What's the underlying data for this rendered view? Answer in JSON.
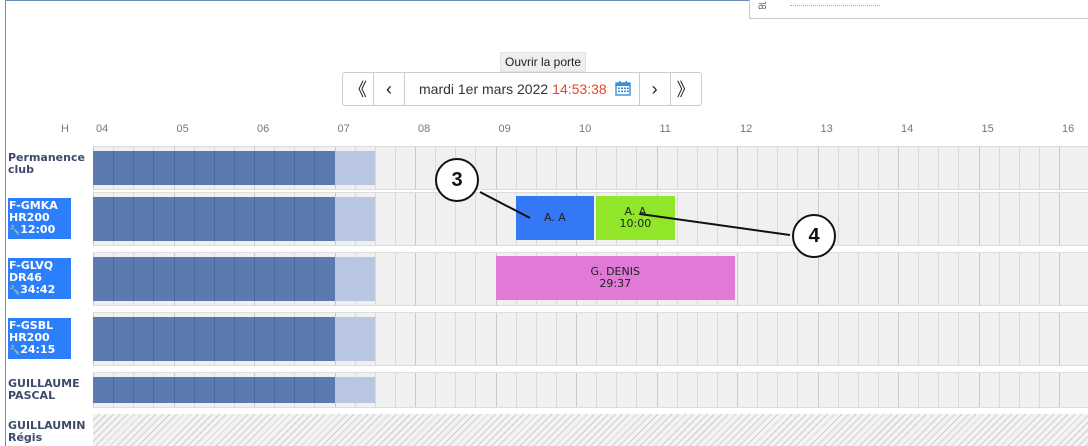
{
  "top_box": {
    "glyph": "ಹ"
  },
  "door_button": "Ouvrir la porte",
  "nav": {
    "first": "《",
    "prev": "‹",
    "date": "mardi 1er mars 2022",
    "time": "14:53:38",
    "next": "›",
    "last": "》"
  },
  "hour_header": "H",
  "hours": [
    "04",
    "05",
    "06",
    "07",
    "08",
    "09",
    "10",
    "11",
    "12",
    "13",
    "14",
    "15",
    "16"
  ],
  "rows": [
    {
      "line1": "Permanence",
      "line2": "club",
      "line3": "",
      "aircraft": false
    },
    {
      "line1": "F-GMKA",
      "line2": "HR200",
      "line3": "12:00",
      "aircraft": true
    },
    {
      "line1": "F-GLVQ",
      "line2": "DR46",
      "line3": "34:42",
      "aircraft": true
    },
    {
      "line1": "F-GSBL",
      "line2": "HR200",
      "line3": "24:15",
      "aircraft": true
    },
    {
      "line1": "GUILLAUME",
      "line2": "PASCAL",
      "line3": "",
      "aircraft": false
    },
    {
      "line1": "GUILLAUMIN",
      "line2": "Régis",
      "line3": "",
      "aircraft": false
    }
  ],
  "bookings": [
    {
      "row": 1,
      "label": "A. A",
      "sub": "",
      "color": "#3478f6"
    },
    {
      "row": 1,
      "label": "A. A",
      "sub": "10:00",
      "color": "#92e62a"
    },
    {
      "row": 2,
      "label": "G. DENIS",
      "sub": "29:37",
      "color": "#e07ad6"
    }
  ],
  "callouts": [
    "3",
    "4"
  ],
  "colors": {
    "night": "#5a7ab0",
    "twilight": "#b8c6e2",
    "accent": "#2b7ffb",
    "time": "#e8462b"
  }
}
